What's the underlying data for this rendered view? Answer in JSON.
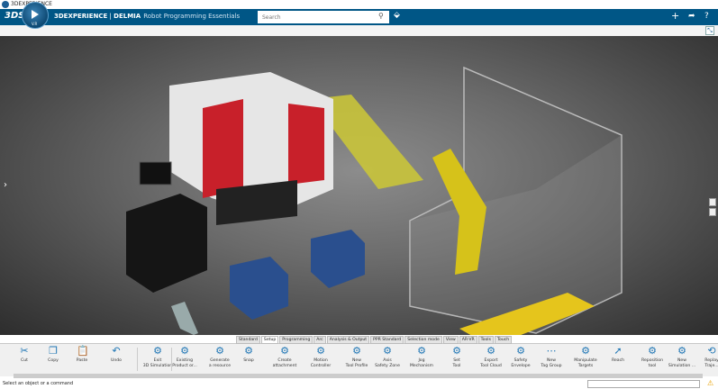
{
  "window": {
    "title": "3DEXPERIENCE"
  },
  "header": {
    "brand": "3DEXPERIENCE",
    "app": "DELMIA",
    "role": "Robot Programming Essentials",
    "compass_version": "V.R",
    "search_placeholder": "Search",
    "color": "#005686"
  },
  "tabs": [
    {
      "label": "Standard"
    },
    {
      "label": "Setup",
      "active": true
    },
    {
      "label": "Programming"
    },
    {
      "label": "Arc"
    },
    {
      "label": "Analysis & Output"
    },
    {
      "label": "PPR Standard"
    },
    {
      "label": "Selection mode"
    },
    {
      "label": "View"
    },
    {
      "label": "AR-VR"
    },
    {
      "label": "Tools"
    },
    {
      "label": "Touch"
    }
  ],
  "toolbar": [
    {
      "label": "Cut",
      "icon": "scissors-icon"
    },
    {
      "label": "Copy",
      "icon": "copy-icon"
    },
    {
      "label": "Paste",
      "icon": "paste-icon"
    },
    {
      "label": "Undo",
      "icon": "undo-icon"
    },
    {
      "label": "Exit\n3D Simulation",
      "icon": "exit-simulation-icon"
    },
    {
      "label": "Existing\nProduct or...",
      "icon": "existing-product-icon"
    },
    {
      "label": "Generate\na resource",
      "icon": "generate-resource-icon"
    },
    {
      "label": "Snap",
      "icon": "snap-icon"
    },
    {
      "label": "Create\nattachment",
      "icon": "attachment-icon"
    },
    {
      "label": "Motion\nController",
      "icon": "motion-controller-icon"
    },
    {
      "label": "New\nTool Profile",
      "icon": "tool-profile-icon"
    },
    {
      "label": "Axis\nSafety Zone",
      "icon": "safety-zone-icon"
    },
    {
      "label": "Jog\nMechanism",
      "icon": "jog-icon"
    },
    {
      "label": "Set\nTool",
      "icon": "set-tool-icon"
    },
    {
      "label": "Export\nTool Cloud",
      "icon": "export-cloud-icon"
    },
    {
      "label": "Safety\nEnvelope",
      "icon": "safety-envelope-icon"
    },
    {
      "label": "New\nTag Group",
      "icon": "tag-group-icon"
    },
    {
      "label": "Manipulate\nTargets",
      "icon": "targets-icon"
    },
    {
      "label": "Reach",
      "icon": "reach-icon"
    },
    {
      "label": "Reposition\ntool",
      "icon": "reposition-icon"
    },
    {
      "label": "New\nSimulation ...",
      "icon": "simulation-icon"
    },
    {
      "label": "Replay\nTraje...",
      "icon": "replay-icon"
    }
  ],
  "status": {
    "message": "Select an object or a command"
  }
}
